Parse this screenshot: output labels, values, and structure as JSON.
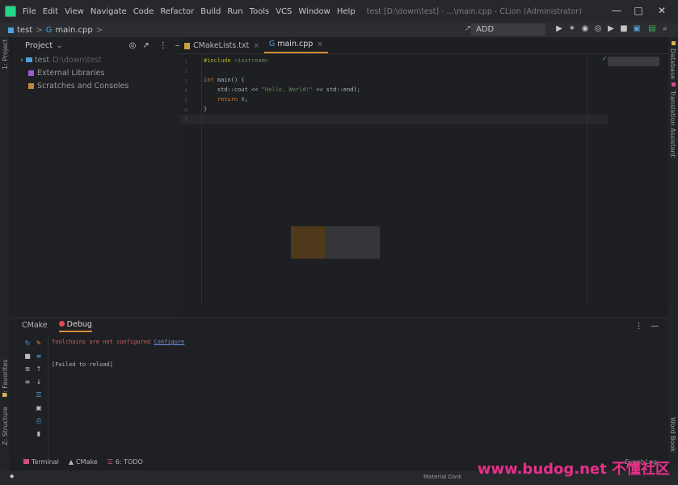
{
  "titlebar": {
    "menus": [
      "File",
      "Edit",
      "View",
      "Navigate",
      "Code",
      "Refactor",
      "Build",
      "Run",
      "Tools",
      "VCS",
      "Window",
      "Help"
    ],
    "title": "test [D:\\down\\test] - ...\\main.cpp - CLion (Administrator)",
    "minimize": "—",
    "maximize": "□",
    "close": "✕"
  },
  "navbar": {
    "project": "test",
    "sep1": ">",
    "file": "main.cpp",
    "sep2": ">",
    "add_configuration": "ADD CONFIGURATION..."
  },
  "left_strip": {
    "project": "1: Project",
    "favorites": "2: Favorites",
    "structure": "Z: Structure"
  },
  "right_strip": {
    "database": "Database",
    "translation": "Translation Assistant",
    "wordbook": "Word Book"
  },
  "project_panel": {
    "header": "Project",
    "header_arrow": "⌄",
    "tree": [
      {
        "name": "test",
        "path": "D:\\down\\test"
      },
      {
        "name": "External Libraries"
      },
      {
        "name": "Scratches and Consoles"
      }
    ]
  },
  "editor": {
    "tabs": [
      {
        "label": "CMakeLists.txt",
        "close": "×"
      },
      {
        "label": "main.cpp",
        "close": "×"
      }
    ],
    "line_numbers": [
      "1",
      "2",
      "3",
      "4",
      "5",
      "6",
      "7"
    ],
    "code": {
      "l1_pre": "#include",
      "l1_hdr": " <iostream>",
      "l3_kw": "int",
      "l3_rest": " main() {",
      "l4_a": "    std::cout << ",
      "l4_str": "\"Hello, World!\"",
      "l4_b": " << std::endl;",
      "l5_kw": "    return",
      "l5_num": " 0",
      "l5_end": ";",
      "l6": "}"
    }
  },
  "bottom_panel": {
    "tabs": [
      {
        "label": "CMake"
      },
      {
        "label": "Debug"
      }
    ],
    "console": {
      "error_text": "Toolchains are not configured ",
      "configure_link": "Configure",
      "failed": "[Failed to reload]"
    }
  },
  "statusbar": {
    "terminal": "Terminal",
    "cmake": "CMake",
    "todo": "6: TODO",
    "event_log": "Event Log",
    "theme": "Material Dark"
  },
  "watermark": "www.budog.net 不懂社区",
  "colors": {
    "accent": "#d68c35",
    "error": "#d65f5f",
    "link": "#6b8fd6",
    "keyword": "#cc7832",
    "string": "#6a8759",
    "number": "#6897bb",
    "preprocessor": "#bbb529"
  }
}
